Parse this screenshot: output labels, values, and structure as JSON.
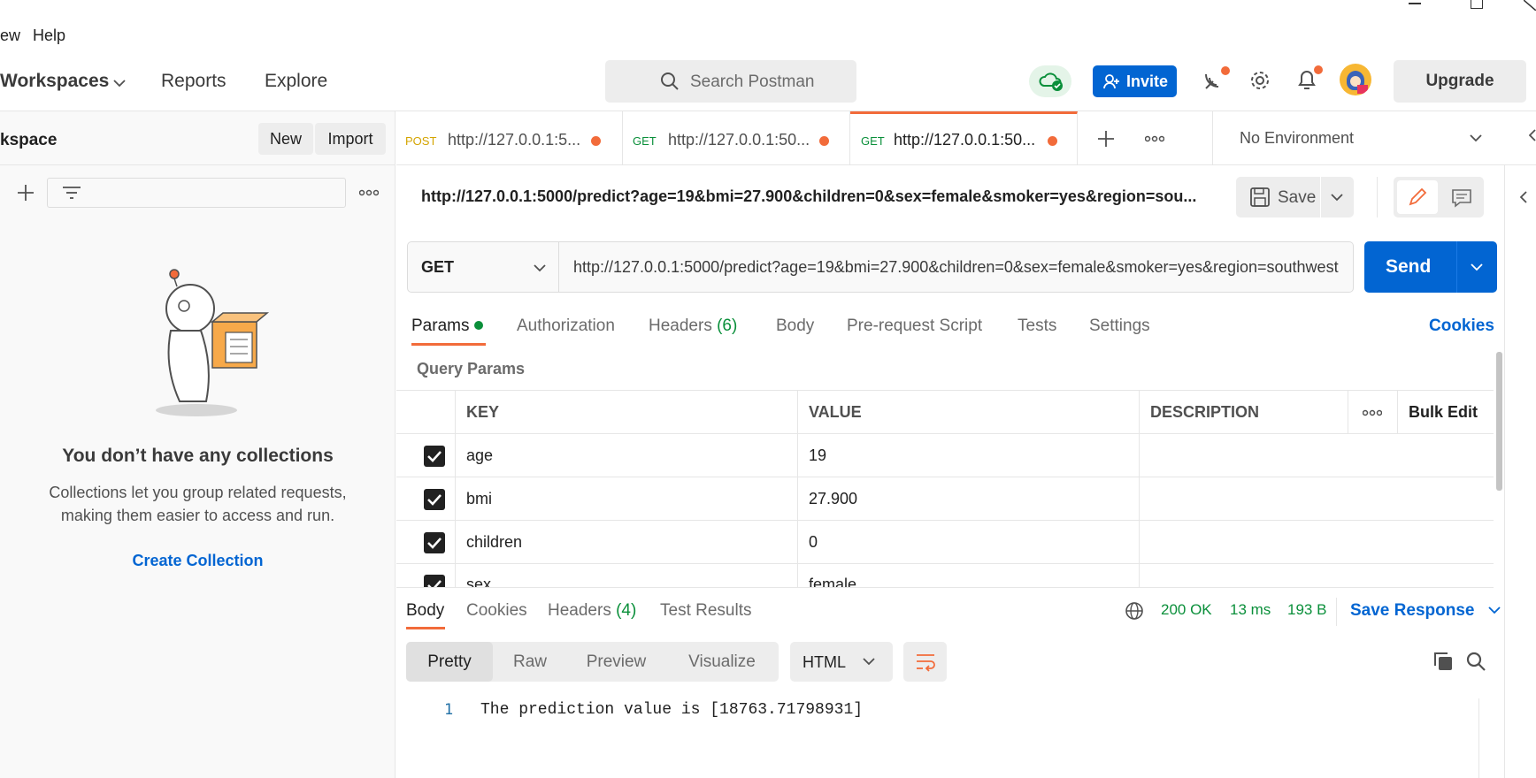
{
  "menu": {
    "view": "ew",
    "help": "Help"
  },
  "header": {
    "workspaces": "Workspaces",
    "reports": "Reports",
    "explore": "Explore",
    "search_placeholder": "Search Postman",
    "invite": "Invite",
    "upgrade": "Upgrade"
  },
  "sidebar": {
    "workspace_title": "kspace",
    "new_label": "New",
    "import_label": "Import",
    "empty_title": "You don’t have any collections",
    "empty_desc": "Collections let you group related requests, making them easier to access and run.",
    "create_collection": "Create Collection"
  },
  "tabs": [
    {
      "method": "POST",
      "url": "http://127.0.0.1:5...",
      "method_color": "#d4a400"
    },
    {
      "method": "GET",
      "url": "http://127.0.0.1:50...",
      "method_color": "#0a8f3a"
    },
    {
      "method": "GET",
      "url": "http://127.0.0.1:50...",
      "method_color": "#0a8f3a"
    }
  ],
  "environment": "No Environment",
  "request": {
    "title": "http://127.0.0.1:5000/predict?age=19&bmi=27.900&children=0&sex=female&smoker=yes&region=sou...",
    "save": "Save",
    "method": "GET",
    "url": "http://127.0.0.1:5000/predict?age=19&bmi=27.900&children=0&sex=female&smoker=yes&region=southwest",
    "send": "Send"
  },
  "request_tabs": {
    "params": "Params",
    "authorization": "Authorization",
    "headers": "Headers",
    "headers_count": "(6)",
    "body": "Body",
    "prerequest": "Pre-request Script",
    "tests": "Tests",
    "settings": "Settings",
    "cookies": "Cookies"
  },
  "query_params": {
    "label": "Query Params",
    "columns": {
      "key": "KEY",
      "value": "VALUE",
      "description": "DESCRIPTION",
      "bulk_edit": "Bulk Edit"
    },
    "rows": [
      {
        "key": "age",
        "value": "19"
      },
      {
        "key": "bmi",
        "value": "27.900"
      },
      {
        "key": "children",
        "value": "0"
      },
      {
        "key": "sex",
        "value": "female"
      }
    ]
  },
  "response": {
    "tabs": {
      "body": "Body",
      "cookies": "Cookies",
      "headers": "Headers",
      "headers_count": "(4)",
      "test_results": "Test Results"
    },
    "status": "200 OK",
    "time": "13 ms",
    "size": "193 B",
    "save_response": "Save Response",
    "views": {
      "pretty": "Pretty",
      "raw": "Raw",
      "preview": "Preview",
      "visualize": "Visualize"
    },
    "language": "HTML",
    "line_number": "1",
    "body_text": "The prediction value is [18763.71798931]"
  },
  "colors": {
    "accent_orange": "#f26b3a",
    "primary_blue": "#0265d2",
    "success_green": "#0a8f3a"
  }
}
